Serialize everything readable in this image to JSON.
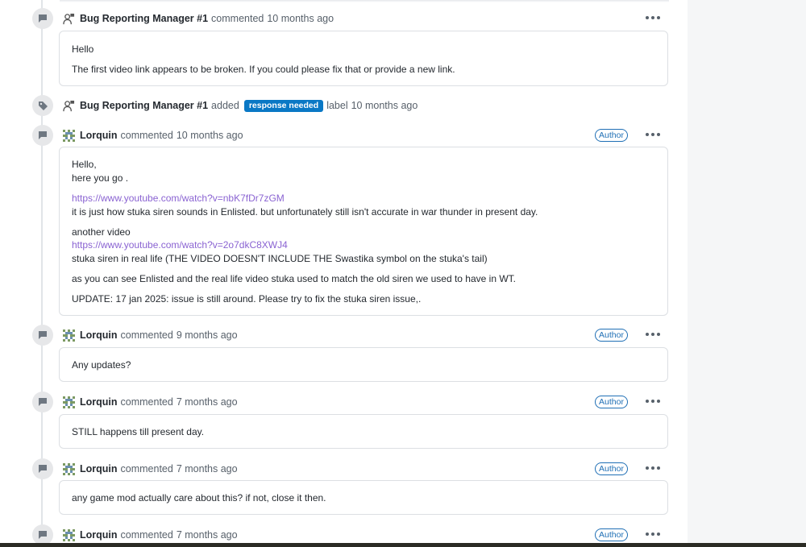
{
  "timeline": {
    "c1": {
      "author": "Bug Reporting Manager #1",
      "action": "commented",
      "time": "10 months ago",
      "line1": "Hello",
      "line2": "The first video link appears to be broken. If you could please fix that or provide a new link."
    },
    "event": {
      "author": "Bug Reporting Manager #1",
      "action": "added",
      "label": "response needed",
      "suffix": "label",
      "time": "10 months ago"
    },
    "c2": {
      "author": "Lorquin",
      "action": "commented",
      "time": "10 months ago",
      "badge": "Author",
      "l1": "Hello,",
      "l2": "here you go .",
      "link1": "https://www.youtube.com/watch?v=nbK7fDr7zGM",
      "l3": "it is just how stuka siren sounds in Enlisted. but unfortunately still isn't accurate in war thunder in present day.",
      "l4": "another video",
      "link2": "https://www.youtube.com/watch?v=2o7dkC8XWJ4",
      "l5": "stuka siren in real life (THE VIDEO DOESN'T INCLUDE THE Swastika symbol on the stuka's tail)",
      "l6": "as you can see Enlisted and the real life video stuka used to match the old siren we used to have in WT.",
      "l7": "UPDATE: 17 jan 2025: issue is still around. Please try to fix the stuka siren issue,."
    },
    "c3": {
      "author": "Lorquin",
      "action": "commented",
      "time": "9 months ago",
      "badge": "Author",
      "body": "Any updates?"
    },
    "c4": {
      "author": "Lorquin",
      "action": "commented",
      "time": "7 months ago",
      "badge": "Author",
      "body": "STILL happens till present day."
    },
    "c5": {
      "author": "Lorquin",
      "action": "commented",
      "time": "7 months ago",
      "badge": "Author",
      "body": "any game mod actually care about this? if not, close it then."
    },
    "c6": {
      "author": "Lorquin",
      "action": "commented",
      "time": "7 months ago",
      "badge": "Author"
    }
  },
  "icons": {
    "comment": "comment-icon",
    "tag": "tag-icon",
    "more": "more-options-icon",
    "manager_avatar": "bug-manager-avatar",
    "user_avatar": "pixel-avatar"
  },
  "colors": {
    "label_badge": "#0a78c5",
    "author_badge": "#1f6fb5",
    "link": "#8a63d2"
  }
}
